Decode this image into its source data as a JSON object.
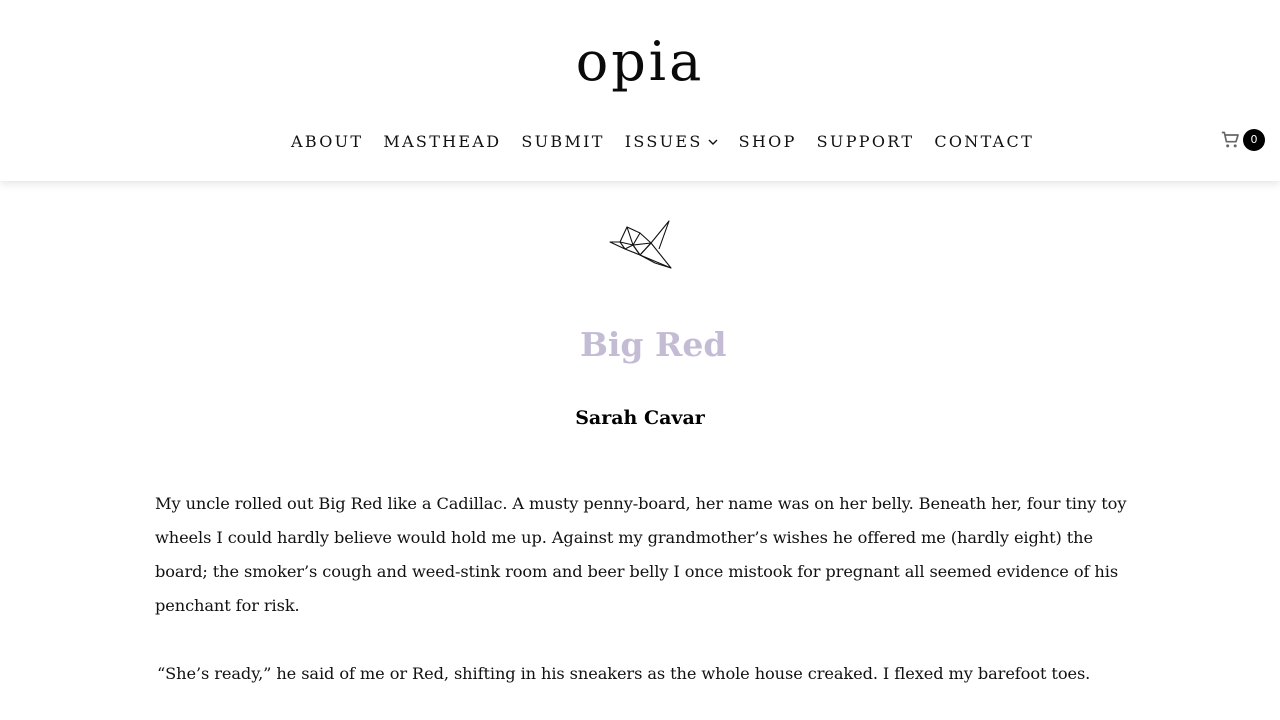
{
  "header": {
    "logo": "opia",
    "nav": [
      {
        "label": "ABOUT"
      },
      {
        "label": "MASTHEAD"
      },
      {
        "label": "SUBMIT"
      },
      {
        "label": "ISSUES",
        "has_dropdown": true
      },
      {
        "label": "SHOP"
      },
      {
        "label": "SUPPORT"
      },
      {
        "label": "CONTACT"
      }
    ],
    "cart": {
      "icon": "cart-icon",
      "count": "0"
    }
  },
  "article": {
    "emblem_icon": "paper-crane-icon",
    "title": "Big Red",
    "author": "Sarah Cavar",
    "lines": [
      "My uncle rolled out Big Red like a Cadillac. A musty penny-board, her name was on her belly. Beneath her, four tiny toy",
      "wheels I could hardly believe would hold me up. Against my grandmother’s wishes he offered me (hardly eight) the",
      "board; the smoker’s cough and weed-stink room and beer belly I once mistook for pregnant all seemed evidence of his",
      "penchant for risk.",
      "“She’s ready,” he said of me or Red, shifting in his sneakers as the whole house creaked. I flexed my barefoot toes."
    ]
  },
  "colors": {
    "title": "#c4bcd4",
    "text": "#111111",
    "badge_bg": "#000000"
  }
}
